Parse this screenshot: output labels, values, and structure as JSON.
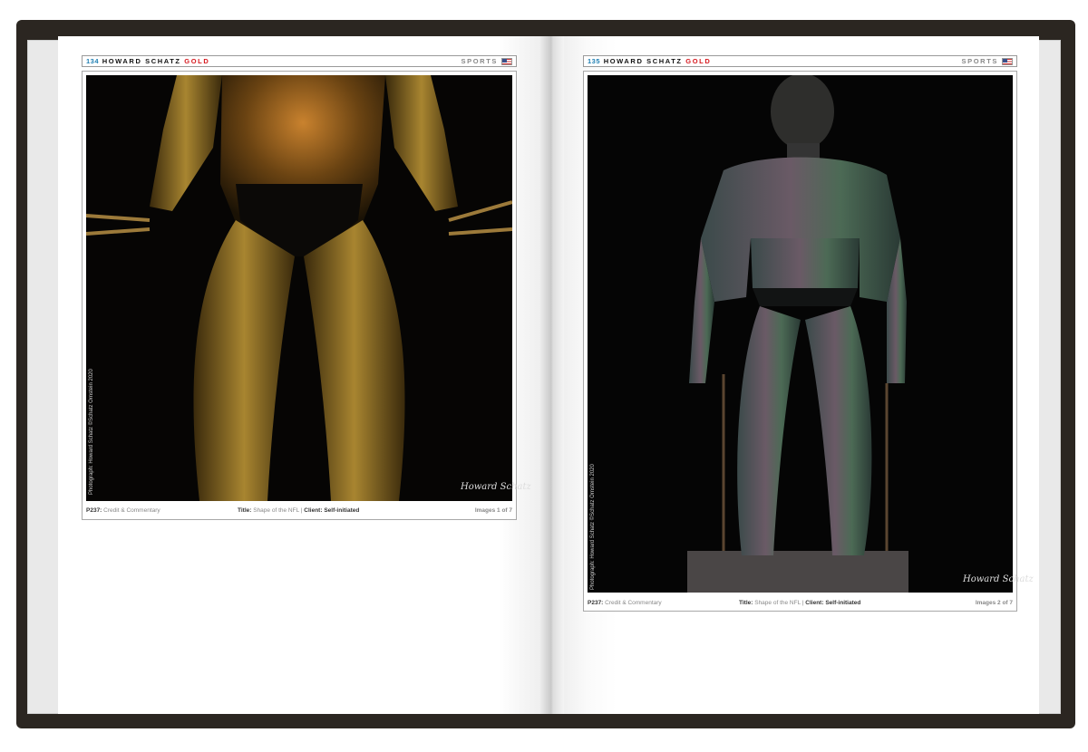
{
  "spread": {
    "left_page": {
      "header": {
        "number": "134",
        "name": "HOWARD SCHATZ",
        "edition": "GOLD",
        "section": "SPORTS",
        "flag_icon": "us-flag-icon"
      },
      "photo_credit": "Photograph: Howard Schatz ©Schatz Ornstein 2020",
      "signature": "Howard Schatz",
      "caption": {
        "ref_label": "P237:",
        "ref_text": "Credit & Commentary",
        "title_label": "Title:",
        "title_text": "Shape of the NFL",
        "separator": "|",
        "client_label": "Client:",
        "client_text": "Self-initiated",
        "count": "Images 1 of 7"
      }
    },
    "right_page": {
      "header": {
        "number": "135",
        "name": "HOWARD SCHATZ",
        "edition": "GOLD",
        "section": "SPORTS",
        "flag_icon": "us-flag-icon"
      },
      "photo_credit": "Photograph: Howard Schatz ©Schatz Ornstein 2020",
      "signature": "Howard Schatz",
      "caption": {
        "ref_label": "P237:",
        "ref_text": "Credit & Commentary",
        "title_label": "Title:",
        "title_text": "Shape of the NFL",
        "separator": "|",
        "client_label": "Client:",
        "client_text": "Self-initiated",
        "count": "Images 2 of 7"
      }
    }
  },
  "colors": {
    "cover": "#2b2621",
    "page_number": "#1f7fb3",
    "gold_label": "#d6181e",
    "photo_background": "#050505"
  }
}
